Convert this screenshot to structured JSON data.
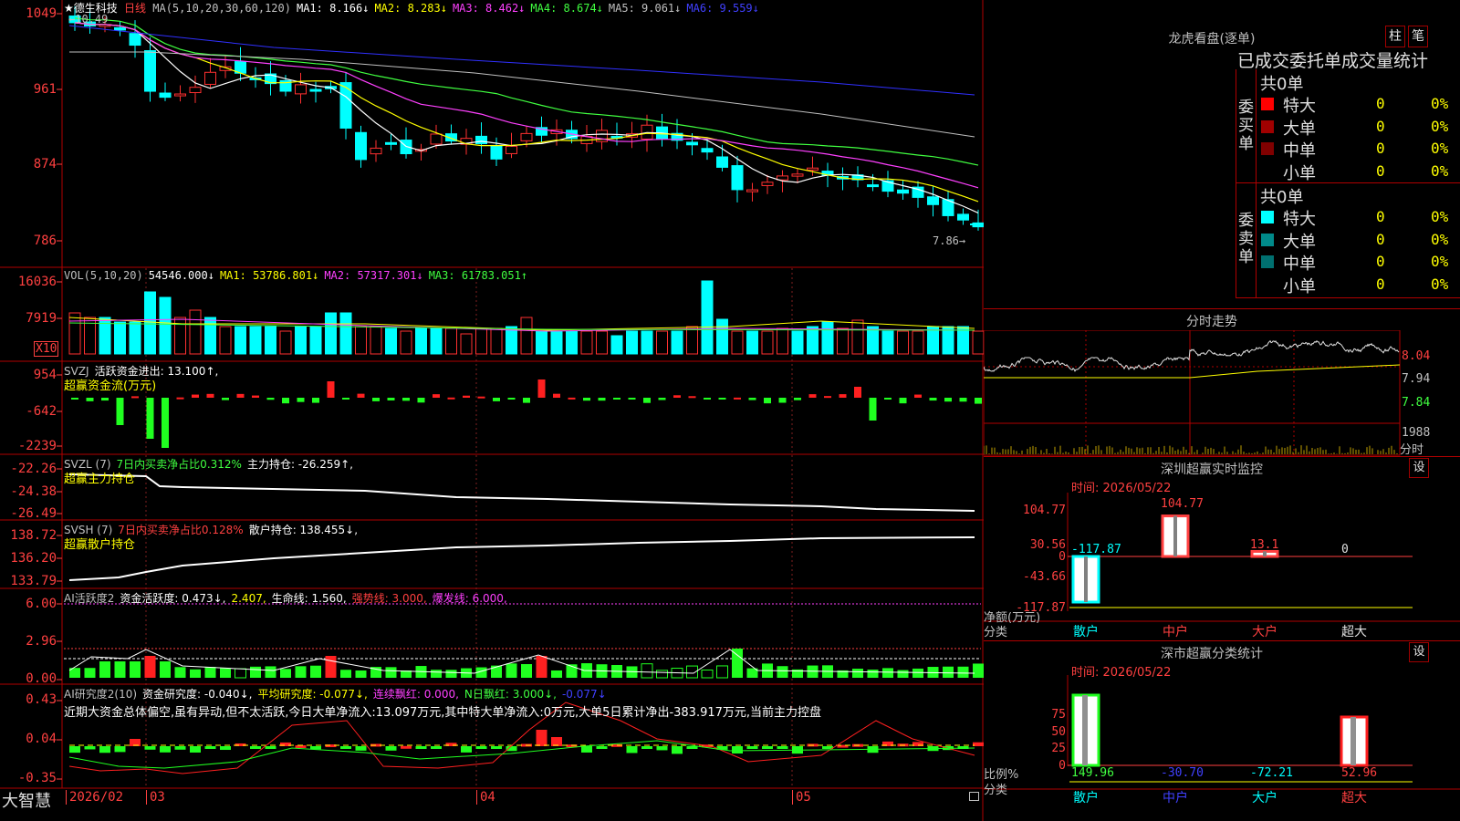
{
  "stock": {
    "name": "★德生科技",
    "period": "日线"
  },
  "panels": {
    "price": {
      "header": [
        {
          "t": "MA(5,10,20,30,60,120)",
          "c": "#c0c0c0"
        },
        {
          "t": "MA1: 8.166↓",
          "c": "#ffffff"
        },
        {
          "t": "MA2: 8.283↓",
          "c": "#ffff00"
        },
        {
          "t": "MA3: 8.462↓",
          "c": "#ff40ff"
        },
        {
          "t": "MA4: 8.674↓",
          "c": "#40ff40"
        },
        {
          "t": "MA5: 9.061↓",
          "c": "#c0c0c0"
        },
        {
          "t": "MA6: 9.559↓",
          "c": "#4040ff"
        }
      ],
      "y_labels": [
        "1049",
        "961",
        "874",
        "786"
      ],
      "high_note": "←10.49",
      "low_note": "7.86→"
    },
    "vol": {
      "header": [
        {
          "t": "VOL(5,10,20)",
          "c": "#c0c0c0"
        },
        {
          "t": "54546.000↓",
          "c": "#ffffff"
        },
        {
          "t": "MA1: 53786.801↓",
          "c": "#ffff00"
        },
        {
          "t": "MA2: 57317.301↓",
          "c": "#ff40ff"
        },
        {
          "t": "MA3: 61783.051↑",
          "c": "#40ff40"
        }
      ],
      "y_labels": [
        "16036",
        "7919"
      ],
      "unit_badge": "X10"
    },
    "svzj": {
      "header": [
        {
          "t": "SVZJ",
          "c": "#c0c0c0"
        },
        {
          "t": "活跃资金进出: 13.100↑,",
          "c": "#ffffff"
        }
      ],
      "subtitle": "超赢资金流(万元)",
      "y_labels": [
        "954",
        "-642",
        "-2239"
      ]
    },
    "svzl": {
      "header": [
        {
          "t": "SVZL (7)",
          "c": "#c0c0c0"
        },
        {
          "t": "7日内买卖净占比0.312%",
          "c": "#40ff40"
        },
        {
          "t": "主力持仓: -26.259↑,",
          "c": "#ffffff"
        }
      ],
      "subtitle": "超赢主力持仓",
      "y_labels": [
        "-22.26",
        "-24.38",
        "-26.49"
      ]
    },
    "svsh": {
      "header": [
        {
          "t": "SVSH (7)",
          "c": "#c0c0c0"
        },
        {
          "t": "7日内买卖净占比0.128%",
          "c": "#ff4040"
        },
        {
          "t": "散户持仓: 138.455↓,",
          "c": "#ffffff"
        }
      ],
      "subtitle": "超赢散户持仓",
      "y_labels": [
        "138.72",
        "136.20",
        "133.79"
      ]
    },
    "ai1": {
      "header": [
        {
          "t": "AI活跃度2",
          "c": "#c0c0c0"
        },
        {
          "t": "资金活跃度: 0.473↓,",
          "c": "#ffffff"
        },
        {
          "t": "2.407,",
          "c": "#ffff00"
        },
        {
          "t": "生命线: 1.560,",
          "c": "#ffffff"
        },
        {
          "t": "强势线: 3.000,",
          "c": "#ff4040"
        },
        {
          "t": "爆发线: 6.000,",
          "c": "#ff40ff"
        }
      ],
      "y_labels": [
        "6.00",
        "2.96",
        "0.00"
      ]
    },
    "ai2": {
      "header": [
        {
          "t": "AI研究度2(10)",
          "c": "#c0c0c0"
        },
        {
          "t": "资金研究度: -0.040↓,",
          "c": "#ffffff"
        },
        {
          "t": "平均研究度: -0.077↓,",
          "c": "#ffff00"
        },
        {
          "t": "连续飘红: 0.000,",
          "c": "#ff40ff"
        },
        {
          "t": "N日飘红: 3.000↓,",
          "c": "#40ff40"
        },
        {
          "t": "-0.077↓",
          "c": "#4040ff"
        }
      ],
      "comment": "近期大资金总体偏空,虽有异动,但不太活跃,今日大单净流入:13.097万元,其中特大单净流入:0万元,大单5日累计净出-383.917万元,当前主力控盘",
      "y_labels": [
        "0.43",
        "0.04",
        "-0.35"
      ]
    }
  },
  "x_axis": {
    "labels": [
      "2026/02",
      "03",
      "04",
      "05"
    ],
    "brand": "大智慧"
  },
  "dragon": {
    "title": "龙虎看盘(逐单)",
    "btn_bar": "柱",
    "btn_pen": "笔",
    "subtitle": "已成交委托单成交量统计",
    "buy": {
      "side": "委买单",
      "total": "共0单",
      "rows": [
        {
          "label": "特大",
          "value": "0",
          "pct": "0%",
          "color": "#ff0000"
        },
        {
          "label": "大单",
          "value": "0",
          "pct": "0%",
          "color": "#a00000"
        },
        {
          "label": "中单",
          "value": "0",
          "pct": "0%",
          "color": "#800000"
        },
        {
          "label": "小单",
          "value": "0",
          "pct": "0%",
          "color": ""
        }
      ]
    },
    "sell": {
      "side": "委卖单",
      "total": "共0单",
      "rows": [
        {
          "label": "特大",
          "value": "0",
          "pct": "0%",
          "color": "#00ffff"
        },
        {
          "label": "大单",
          "value": "0",
          "pct": "0%",
          "color": "#008a8a"
        },
        {
          "label": "中单",
          "value": "0",
          "pct": "0%",
          "color": "#007070"
        },
        {
          "label": "小单",
          "value": "0",
          "pct": "0%",
          "color": ""
        }
      ]
    }
  },
  "intraday": {
    "title": "分时走势",
    "y_labels": [
      "8.04",
      "7.94",
      "7.84"
    ],
    "vol_label": "1988",
    "vol_unit": "分时"
  },
  "sz_monitor": {
    "title": "深圳超赢实时监控",
    "set": "设",
    "time": "时间: 2026/05/22",
    "y_labels": [
      "104.77",
      "30.56",
      "0",
      "-43.66",
      "-117.87"
    ],
    "y_unit": "净额(万元)",
    "cat_label": "分类",
    "categories": [
      "散户",
      "中户",
      "大户",
      "超大"
    ],
    "values": [
      -117.87,
      104.77,
      13.1,
      0
    ],
    "value_labels": [
      "-117.87",
      "104.77",
      "13.1",
      "0"
    ]
  },
  "sz_class": {
    "title": "深市超赢分类统计",
    "set": "设",
    "time": "时间: 2026/05/22",
    "y_labels": [
      "75",
      "50",
      "25",
      "0"
    ],
    "y_unit": "比例%",
    "cat_label": "分类",
    "categories": [
      "散户",
      "中户",
      "大户",
      "超大"
    ],
    "value_labels": [
      "149.96",
      "-30.70",
      "-72.21",
      "52.96"
    ]
  }
}
